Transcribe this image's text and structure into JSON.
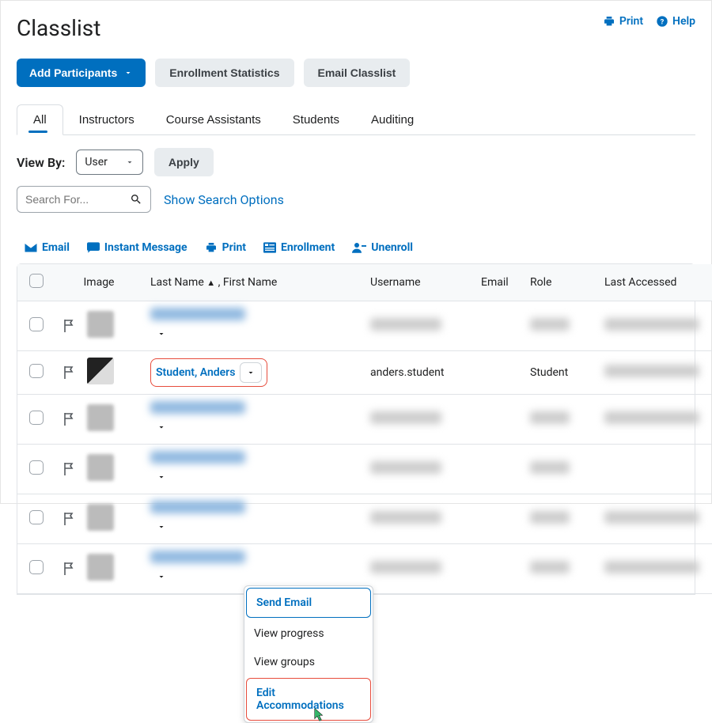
{
  "colors": {
    "primary": "#006fbf",
    "highlight_border": "#e74c3c"
  },
  "header": {
    "title": "Classlist",
    "print": "Print",
    "help": "Help"
  },
  "buttons": {
    "add_participants": "Add Participants",
    "enrollment_stats": "Enrollment Statistics",
    "email_classlist": "Email Classlist"
  },
  "tabs": [
    "All",
    "Instructors",
    "Course Assistants",
    "Students",
    "Auditing"
  ],
  "viewby": {
    "label": "View By:",
    "value": "User",
    "apply": "Apply"
  },
  "search": {
    "placeholder": "Search For...",
    "show_options": "Show Search Options"
  },
  "actions": {
    "email": "Email",
    "im": "Instant Message",
    "print": "Print",
    "enrollment": "Enrollment",
    "unenroll": "Unenroll"
  },
  "table": {
    "headers": {
      "image": "Image",
      "name_prefix": "Last Name",
      "name_suffix": ", First Name",
      "username": "Username",
      "email": "Email",
      "role": "Role",
      "last_accessed": "Last Accessed"
    },
    "rows": [
      {
        "name_blur": true,
        "username_blur": true,
        "role_blur": true,
        "last_blur": true
      },
      {
        "name": "Student, Anders",
        "username": "anders.student",
        "role": "Student",
        "last_blur": true,
        "highlighted": true,
        "avatar_sharp": true
      },
      {
        "name_blur": true,
        "username_blur": true,
        "role_blur": true,
        "last_blur": true
      },
      {
        "name_blur": true,
        "username_blur": true,
        "role_blur": true,
        "last_blur": false
      },
      {
        "name_blur": true,
        "username_blur": true,
        "role_blur": true,
        "last_blur": true
      },
      {
        "name_blur": true,
        "username_blur": true,
        "role_blur": true,
        "last_blur": true
      }
    ]
  },
  "dropdown": {
    "items": [
      "Send Email",
      "View progress",
      "View groups",
      "Edit Accommodations"
    ],
    "selected_index": 0,
    "highlighted_index": 3
  }
}
